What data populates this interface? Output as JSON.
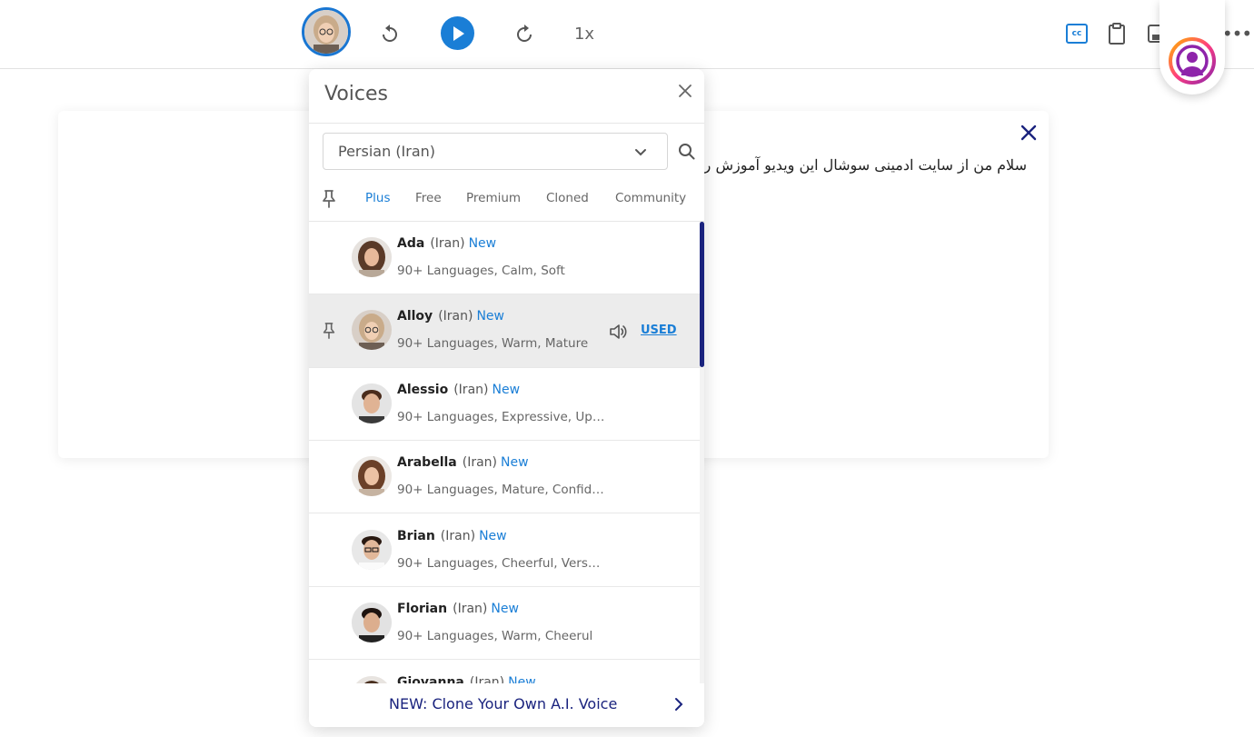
{
  "toolbar": {
    "speed": "1x",
    "cc_label": "cc",
    "more": "•••",
    "accent": "#1a7ed6"
  },
  "card": {
    "text": "سلام من از سایت ادمینی سوشال این ویدیو آموزش ر"
  },
  "voices_panel": {
    "title": "Voices",
    "language": "Persian (Iran)",
    "tabs": [
      {
        "label": "Plus",
        "active": true
      },
      {
        "label": "Free",
        "active": false
      },
      {
        "label": "Premium",
        "active": false
      },
      {
        "label": "Cloned",
        "active": false
      },
      {
        "label": "Community",
        "active": false
      }
    ],
    "voices": [
      {
        "name": "Ada",
        "region": "(Iran)",
        "tag": "New",
        "desc": "90+ Languages, Calm, Soft"
      },
      {
        "name": "Alloy",
        "region": "(Iran)",
        "tag": "New",
        "desc": "90+ Languages, Warm, Mature",
        "selected": true,
        "used_label": "USED"
      },
      {
        "name": "Alessio",
        "region": "(Iran)",
        "tag": "New",
        "desc": "90+ Languages, Expressive, Up…"
      },
      {
        "name": "Arabella",
        "region": "(Iran)",
        "tag": "New",
        "desc": "90+ Languages, Mature, Confid…"
      },
      {
        "name": "Brian",
        "region": "(Iran)",
        "tag": "New",
        "desc": "90+ Languages, Cheerful, Vers…"
      },
      {
        "name": "Florian",
        "region": "(Iran)",
        "tag": "New",
        "desc": "90+ Languages, Warm, Cheerul"
      },
      {
        "name": "Giovanna",
        "region": "(Iran)",
        "tag": "New",
        "desc": ""
      }
    ],
    "footer": "NEW: Clone Your Own A.I. Voice",
    "thumb_color": "#1a237e"
  }
}
